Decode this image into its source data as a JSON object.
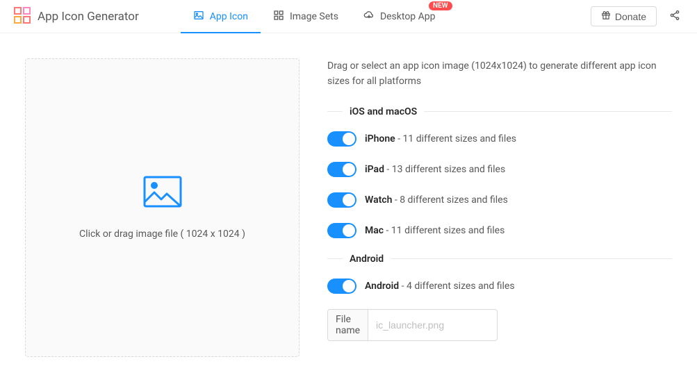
{
  "header": {
    "title": "App Icon Generator",
    "tabs": [
      {
        "label": "App Icon",
        "active": true,
        "icon": "image-icon"
      },
      {
        "label": "Image Sets",
        "active": false,
        "icon": "grid-icon"
      },
      {
        "label": "Desktop App",
        "active": false,
        "icon": "cloud-download-icon",
        "badge": "NEW"
      }
    ],
    "donate_label": "Donate"
  },
  "dropzone": {
    "text": "Click or drag image file ( 1024 x 1024 )"
  },
  "intro": "Drag or select an app icon image (1024x1024) to generate different app icon sizes for all platforms",
  "sections": {
    "ios": {
      "title": "iOS and macOS",
      "items": [
        {
          "name": "iPhone",
          "detail": " - 11 different sizes and files",
          "on": true
        },
        {
          "name": "iPad",
          "detail": " - 13 different sizes and files",
          "on": true
        },
        {
          "name": "Watch",
          "detail": " - 8 different sizes and files",
          "on": true
        },
        {
          "name": "Mac",
          "detail": " - 11 different sizes and files",
          "on": true
        }
      ]
    },
    "android": {
      "title": "Android",
      "items": [
        {
          "name": "Android",
          "detail": " - 4 different sizes and files",
          "on": true
        }
      ],
      "filename": {
        "addon": "File name",
        "placeholder": "ic_launcher.png",
        "value": ""
      }
    }
  }
}
